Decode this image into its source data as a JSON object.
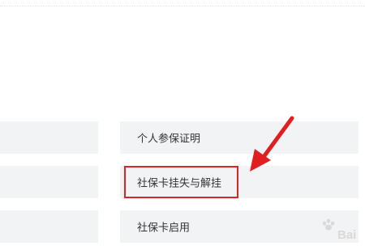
{
  "services": {
    "left_column": [
      {
        "label": ""
      },
      {
        "label": ""
      },
      {
        "label": ""
      }
    ],
    "right_column": [
      {
        "label": "个人参保证明"
      },
      {
        "label": "社保卡挂失与解挂"
      },
      {
        "label": "社保卡启用"
      }
    ]
  },
  "annotation": {
    "highlight_color": "#d6262a",
    "arrow_color": "#e02020",
    "arrow_icon": "red-arrow-icon"
  },
  "watermark": {
    "text": "Bai"
  }
}
